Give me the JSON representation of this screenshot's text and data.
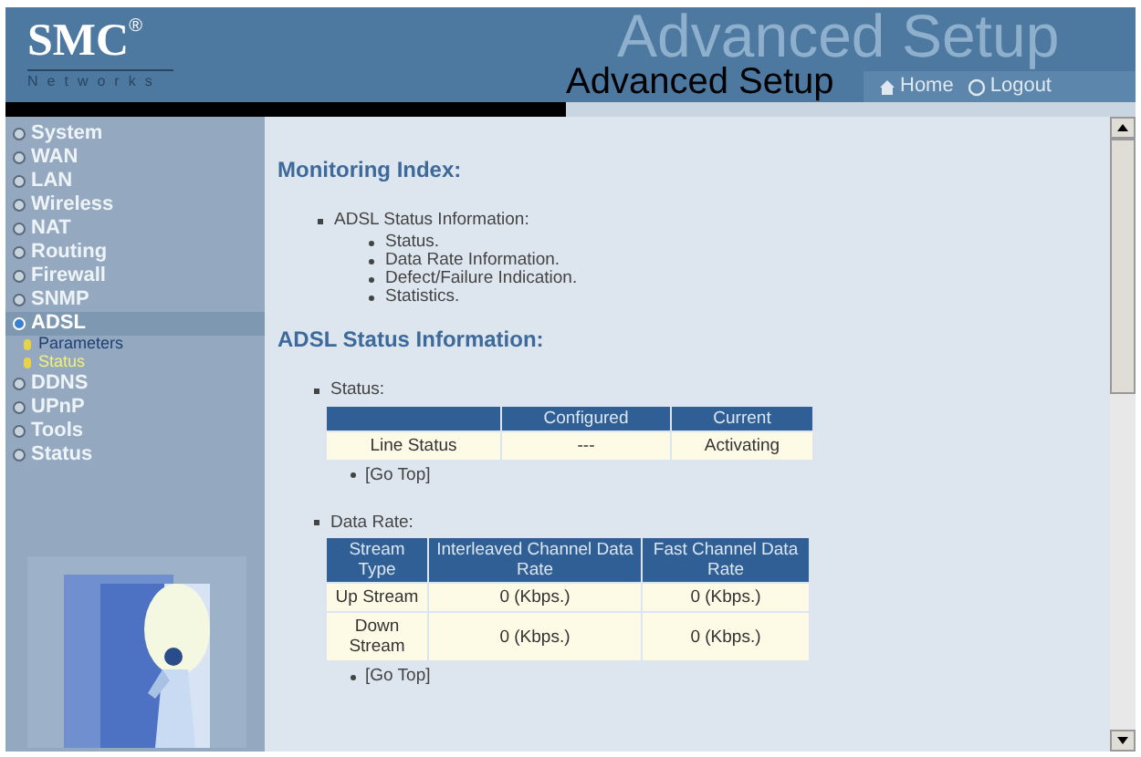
{
  "header": {
    "logo": "SMC",
    "logo_mark": "®",
    "logo_sub": "Networks",
    "banner_text": "Advanced Setup",
    "title": "Advanced Setup",
    "links": [
      {
        "label": "Home",
        "kind": "home"
      },
      {
        "label": "Logout",
        "kind": "logout"
      }
    ]
  },
  "sidebar": {
    "items": [
      {
        "label": "System",
        "selected": false
      },
      {
        "label": "WAN",
        "selected": false
      },
      {
        "label": "LAN",
        "selected": false
      },
      {
        "label": "Wireless",
        "selected": false
      },
      {
        "label": "NAT",
        "selected": false
      },
      {
        "label": "Routing",
        "selected": false
      },
      {
        "label": "Firewall",
        "selected": false
      },
      {
        "label": "SNMP",
        "selected": false
      },
      {
        "label": "ADSL",
        "selected": true,
        "children": [
          {
            "label": "Parameters",
            "selected": false
          },
          {
            "label": "Status",
            "selected": true
          }
        ]
      },
      {
        "label": "DDNS",
        "selected": false
      },
      {
        "label": "UPnP",
        "selected": false
      },
      {
        "label": "Tools",
        "selected": false
      },
      {
        "label": "Status",
        "selected": false
      }
    ]
  },
  "content": {
    "index_heading": "Monitoring Index:",
    "index": {
      "label": "ADSL Status Information:",
      "children": [
        "Status.",
        "Data Rate Information.",
        "Defect/Failure Indication.",
        "Statistics."
      ]
    },
    "section_heading": "ADSL Status Information:",
    "status": {
      "label": "Status:",
      "columns": [
        "",
        "Configured",
        "Current"
      ],
      "rows": [
        [
          "Line Status",
          "---",
          "Activating"
        ]
      ],
      "go_top": "[Go Top]"
    },
    "data_rate": {
      "label": "Data Rate:",
      "columns": [
        "Stream Type",
        "Interleaved Channel Data Rate",
        "Fast Channel Data Rate"
      ],
      "rows": [
        [
          "Up Stream",
          "0 (Kbps.)",
          "0 (Kbps.)"
        ],
        [
          "Down Stream",
          "0 (Kbps.)",
          "0 (Kbps.)"
        ]
      ],
      "go_top": "[Go Top]"
    }
  }
}
